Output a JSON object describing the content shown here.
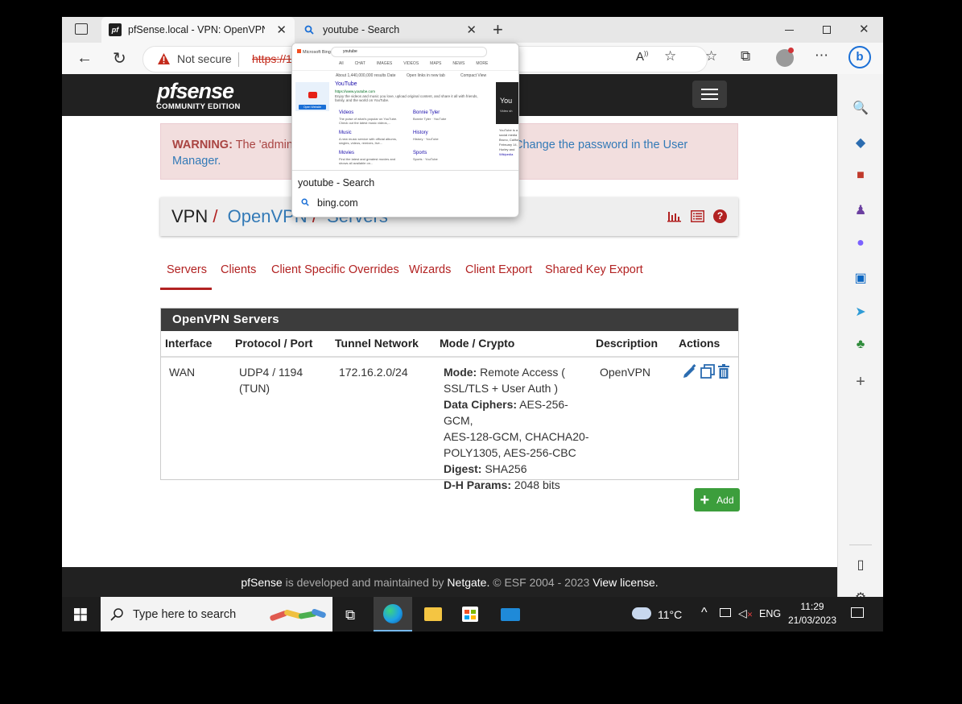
{
  "browser": {
    "tabs": [
      {
        "title": "pfSense.local - VPN: OpenVPN: S",
        "favicon": "pf"
      },
      {
        "title": "youtube - Search",
        "favicon": "search-icon"
      }
    ],
    "address": {
      "security": "Not secure",
      "url": "https://1"
    },
    "hover_preview": {
      "title": "youtube - Search",
      "domain": "bing.com",
      "thumb": {
        "brand": "Microsoft Bing",
        "query": "youtube",
        "filters": [
          "All",
          "CHAT",
          "IMAGES",
          "VIDEOS",
          "MAPS",
          "NEWS",
          "MORE"
        ],
        "results_count": "About 1,440,000,000 results",
        "date": "Date",
        "open_new_tab": "Open links in new tab",
        "compact": "Compact View",
        "result_title": "YouTube",
        "result_url": "https://www.youtube.com",
        "result_desc": "Enjoy the videos and music you love, upload original content, and share it all with friends, family, and the world on YouTube.",
        "open_website": "Open Website",
        "sublinks": [
          {
            "title": "Videos",
            "desc": "The pulse of what's popular on YouTube. Check out the latest music videos,..."
          },
          {
            "title": "Bonnie Tyler",
            "desc": "Bonnie Tyler · YouTube"
          },
          {
            "title": "Music",
            "desc": "A new music service with official albums, singles, videos, remixes, live..."
          },
          {
            "title": "History",
            "desc": "History · YouTube"
          },
          {
            "title": "Movies",
            "desc": "Find the latest and greatest movies and shows all available on..."
          },
          {
            "title": "Sports",
            "desc": "Sports · YouTube"
          }
        ],
        "side_card": "You",
        "side_sub": "Video sh",
        "side_text": [
          "YouTube is a",
          "social media",
          "Bruno, Califor",
          "February 14,",
          "Hurley and",
          "Wikipedia"
        ]
      }
    }
  },
  "pfsense": {
    "logo": "pfsense",
    "edition": "COMMUNITY EDITION",
    "warning": {
      "label": "WARNING:",
      "text": " The 'admin' a",
      "link": "Change the password in the User",
      "link2": "Manager."
    },
    "breadcrumb": {
      "root": "VPN",
      "sep1": "/",
      "mid": "OpenVPN",
      "sep2": "/",
      "leaf": "Servers"
    },
    "tabs": [
      "Servers",
      "Clients",
      "Client Specific Overrides",
      "Wizards",
      "Client Export",
      "Shared Key Export"
    ],
    "active_tab": "Servers",
    "table": {
      "title": "OpenVPN Servers",
      "headers": [
        "Interface",
        "Protocol / Port",
        "Tunnel Network",
        "Mode / Crypto",
        "Description",
        "Actions"
      ],
      "row": {
        "interface": "WAN",
        "protocol_line1": "UDP4 / 1194",
        "protocol_line2": "(TUN)",
        "tunnel": "172.16.2.0/24",
        "mode_label": "Mode:",
        "mode_value1": " Remote Access (",
        "mode_value2": "SSL/TLS + User Auth )",
        "ciphers_label": "Data Ciphers:",
        "ciphers_value1": " AES-256-GCM,",
        "ciphers_value2": "AES-128-GCM, CHACHA20-",
        "ciphers_value3": "POLY1305, AES-256-CBC",
        "digest_label": "Digest:",
        "digest_value": " SHA256",
        "dh_label": "D-H Params:",
        "dh_value": " 2048 bits",
        "description": "OpenVPN"
      }
    },
    "add_button": "Add",
    "footer": {
      "brand": "pfSense",
      "text1": " is developed and maintained by ",
      "company": "Netgate.",
      "text2": " © ESF 2004 - 2023 ",
      "license": "View license."
    },
    "colors": {
      "accent": "#b22222",
      "header_bg": "#212121",
      "success": "#3c9e3c",
      "link": "#337ab7"
    }
  },
  "taskbar": {
    "search_placeholder": "Type here to search",
    "weather": "11°C",
    "language": "ENG",
    "time": "11:29",
    "date": "21/03/2023"
  }
}
